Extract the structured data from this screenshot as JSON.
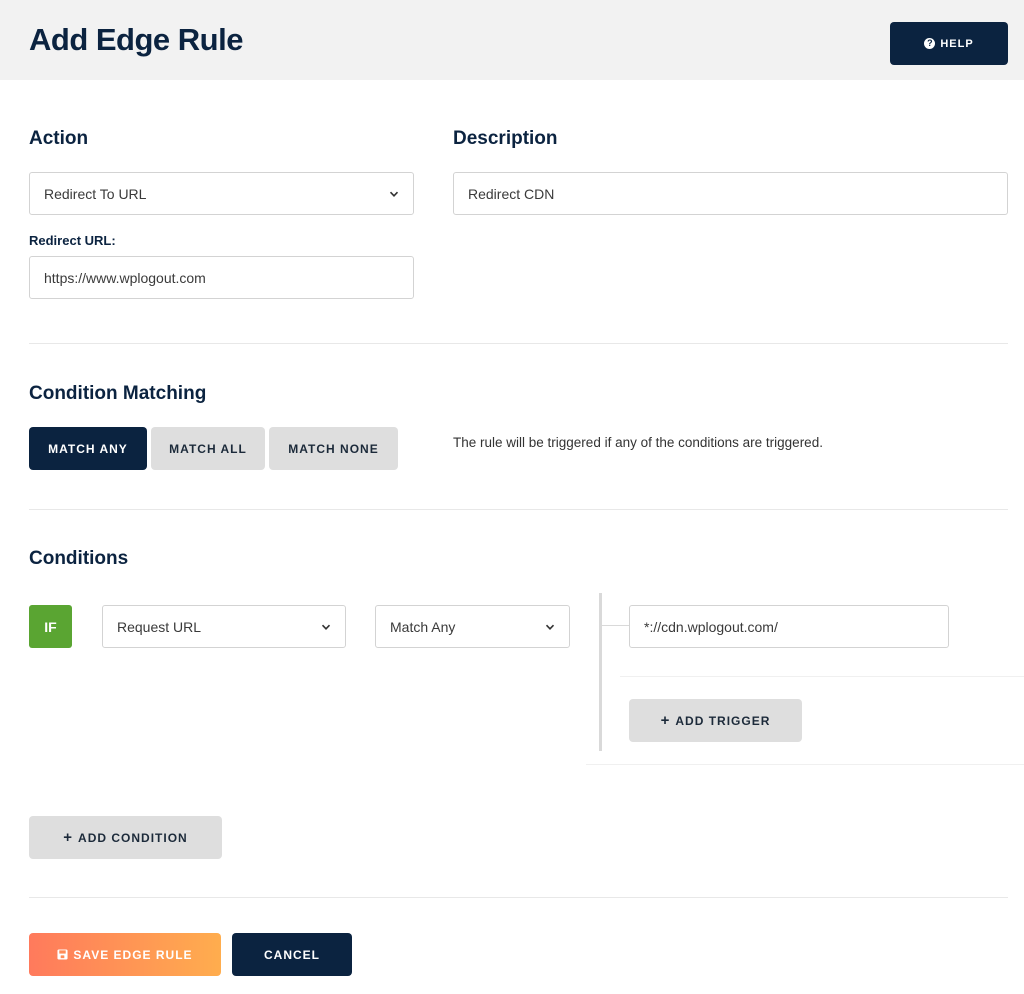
{
  "header": {
    "title": "Add Edge Rule",
    "help_label": "HELP",
    "help_icon": "question-circle-icon"
  },
  "action": {
    "title": "Action",
    "selected": "Redirect To URL",
    "redirect_url_label": "Redirect URL:",
    "redirect_url_value": "https://www.wplogout.com"
  },
  "description": {
    "title": "Description",
    "value": "Redirect CDN"
  },
  "condition_matching": {
    "title": "Condition Matching",
    "buttons": [
      "MATCH ANY",
      "MATCH ALL",
      "MATCH NONE"
    ],
    "active": "MATCH ANY",
    "description": "The rule will be triggered if any of the conditions are triggered."
  },
  "conditions": {
    "title": "Conditions",
    "rows": [
      {
        "badge": "IF",
        "type": "Request URL",
        "match": "Match Any",
        "triggers": [
          "*://cdn.wplogout.com/"
        ],
        "add_trigger_label": "ADD TRIGGER"
      }
    ],
    "add_condition_label": "ADD CONDITION"
  },
  "footer": {
    "save_label": "SAVE EDGE RULE",
    "cancel_label": "CANCEL"
  },
  "colors": {
    "navy": "#0b2340",
    "grey_button": "#dedede",
    "green_badge": "#5aa532",
    "orange_start": "#ff7a5c",
    "orange_end": "#ffad4e"
  }
}
